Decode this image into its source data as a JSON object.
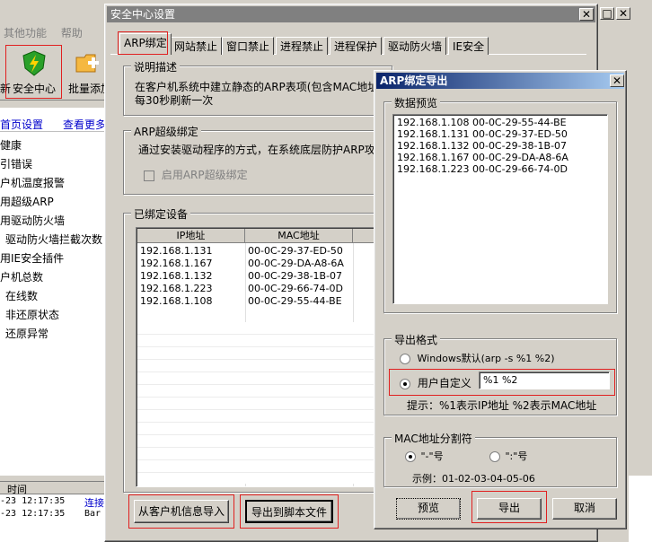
{
  "bg_app": {
    "menu": [
      "其他功能",
      "帮助"
    ],
    "toolbar": [
      "安全中心",
      "批量添加"
    ],
    "left_prefix": "新",
    "links": [
      "首页设置",
      "查看更多"
    ],
    "tree": [
      "健康",
      "引错误",
      "户机温度报警",
      "用超级ARP",
      "用驱动防火墙",
      "驱动防火墙拦截次数",
      "用IE安全插件",
      "户机总数",
      "在线数",
      "非还原状态",
      "还原异常"
    ],
    "log_header": "时间",
    "log_rows": [
      {
        "time": "-23 12:17:35",
        "msg": "连接"
      },
      {
        "time": "-23 12:17:35",
        "msg": "Bar"
      }
    ]
  },
  "main_dialog": {
    "title": "安全中心设置",
    "close": "✕",
    "tabs": [
      "ARP绑定",
      "网站禁止",
      "窗口禁止",
      "进程禁止",
      "进程保护",
      "驱动防火墙",
      "IE安全"
    ],
    "desc_title": "说明描述",
    "desc_text_1": "在客户机系统中建立静态的ARP表项(包含MAC地址,",
    "desc_text_2": "每30秒刷新一次",
    "arp_super_title": "ARP超级绑定",
    "arp_super_text": "通过安装驱动程序的方式，在系统底层防护ARP攻",
    "arp_super_check": "启用ARP超级绑定",
    "bound_title": "已绑定设备",
    "col_ip": "IP地址",
    "col_mac": "MAC地址",
    "rows": [
      {
        "ip": "192.168.1.131",
        "mac": "00-0C-29-37-ED-50"
      },
      {
        "ip": "192.168.1.167",
        "mac": "00-0C-29-DA-A8-6A"
      },
      {
        "ip": "192.168.1.132",
        "mac": "00-0C-29-38-1B-07"
      },
      {
        "ip": "192.168.1.223",
        "mac": "00-0C-29-66-74-0D"
      },
      {
        "ip": "192.168.1.108",
        "mac": "00-0C-29-55-44-BE"
      }
    ],
    "import_btn": "从客户机信息导入",
    "export_script_btn": "导出到脚本文件"
  },
  "export_dialog": {
    "title": "ARP绑定导出",
    "close": "✕",
    "preview_title": "数据预览",
    "preview_lines": [
      "192.168.1.108 00-0C-29-55-44-BE",
      "192.168.1.131 00-0C-29-37-ED-50",
      "192.168.1.132 00-0C-29-38-1B-07",
      "192.168.1.167 00-0C-29-DA-A8-6A",
      "192.168.1.223 00-0C-29-66-74-0D"
    ],
    "format_title": "导出格式",
    "format_windows": "Windows默认(arp -s %1 %2)",
    "format_custom": "用户自定义",
    "format_custom_value": "%1 %2",
    "hint": "提示：%1表示IP地址 %2表示MAC地址",
    "sep_title": "MAC地址分割符",
    "sep_dash": "\"-\"号",
    "sep_colon": "\":\"号",
    "example": "示例：01-02-03-04-05-06",
    "preview_btn": "预览",
    "export_btn": "导出",
    "cancel_btn": "取消"
  },
  "colors": {
    "titlebar": "#0a246a",
    "titlebar_inactive": "#808080",
    "highlight_red": "#e02020",
    "link": "#0000cc"
  }
}
